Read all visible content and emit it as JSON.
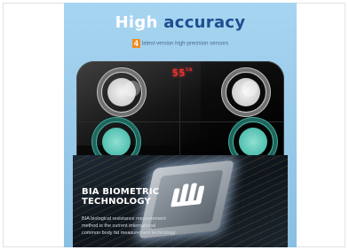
{
  "headline": {
    "word1": "High",
    "word2": "accuracy"
  },
  "subline": {
    "number": "4",
    "text": "latest-version high-precision sensors"
  },
  "scale": {
    "display_value": "55",
    "display_unit": "lb"
  },
  "tech": {
    "title_line1": "BIA BIOMETRIC",
    "title_line2": "TECHNOLOGY",
    "desc_line1": "BIA biological resistance measurement",
    "desc_line2": "method is the current international",
    "desc_line3": "common body fat measurement technology"
  }
}
